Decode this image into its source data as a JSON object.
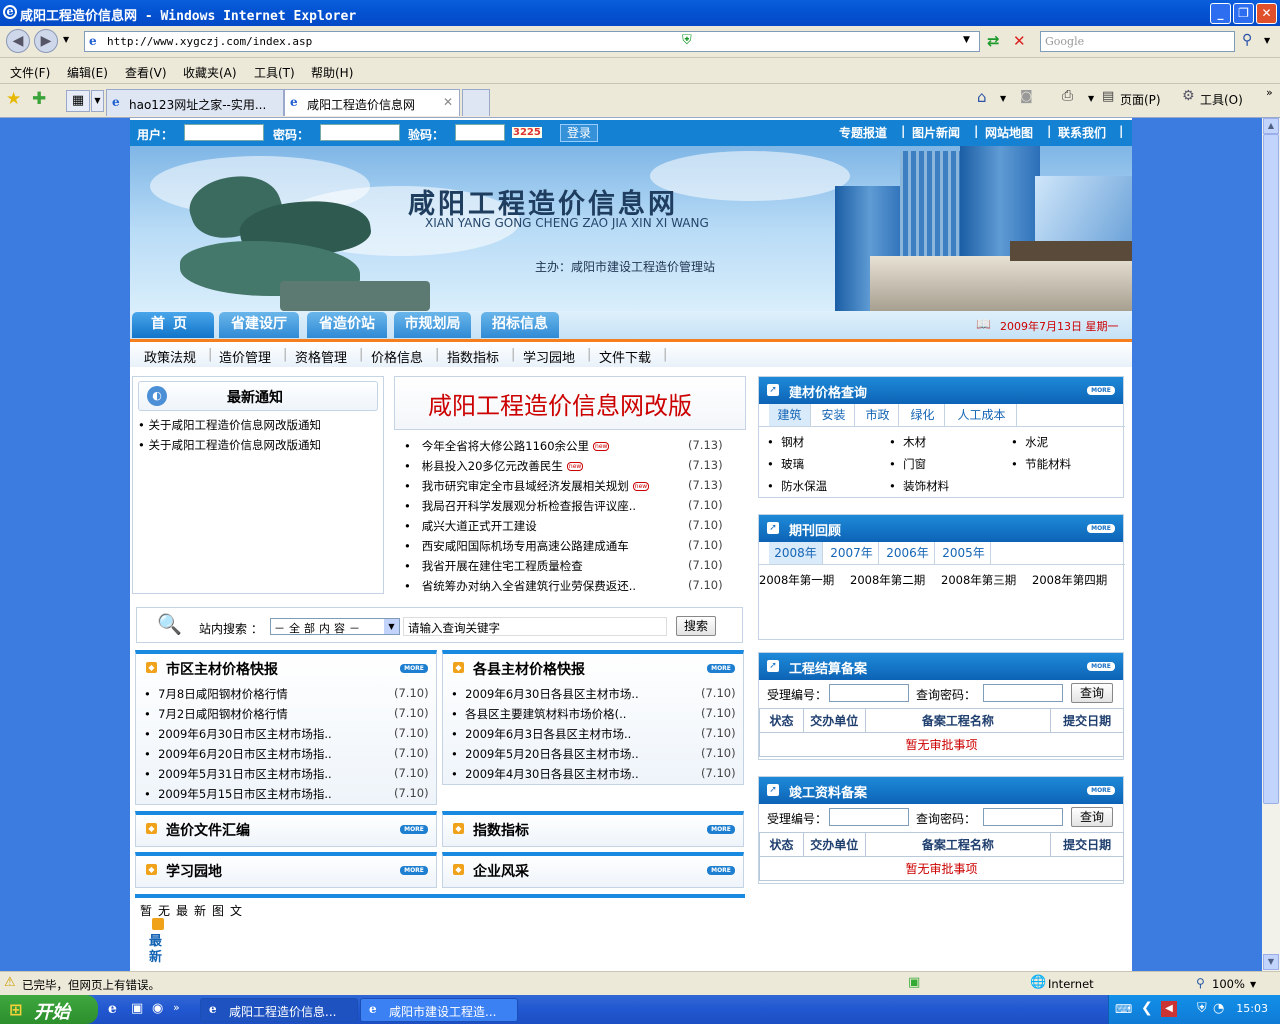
{
  "window": {
    "title": "咸阳工程造价信息网 - Windows Internet Explorer"
  },
  "address": {
    "url": "http://www.xygczj.com/index.asp",
    "search_placeholder": "Google"
  },
  "menu": [
    "文件(F)",
    "编辑(E)",
    "查看(V)",
    "收藏夹(A)",
    "工具(T)",
    "帮助(H)"
  ],
  "browser_tabs": [
    {
      "label": "hao123网址之家--实用..."
    },
    {
      "label": "咸阳工程造价信息网"
    }
  ],
  "toolbar_right": {
    "page": "页面(P)",
    "tools": "工具(O)"
  },
  "login": {
    "user_label": "用户：",
    "pass_label": "密码：",
    "code_label": "验码：",
    "code_value": "3225",
    "login_button": "登录"
  },
  "top_links": [
    "专题报道",
    "图片新闻",
    "网站地图",
    "联系我们"
  ],
  "banner": {
    "title": "咸阳工程造价信息网",
    "pinyin": "XIAN YANG GONG CHENG ZAO JIA XIN XI WANG",
    "sponsor": "主办：咸阳市建设工程造价管理站"
  },
  "main_nav": [
    "首页",
    "省建设厅",
    "省造价站",
    "市规划局",
    "招标信息"
  ],
  "date": "2009年7月13日 星期一",
  "sub_nav": [
    "政策法规",
    "造价管理",
    "资格管理",
    "价格信息",
    "指数指标",
    "学习园地",
    "文件下载"
  ],
  "notices": {
    "title": "最新通知",
    "items": [
      "关于咸阳工程造价信息网改版通知",
      "关于咸阳工程造价信息网改版通知"
    ]
  },
  "headline": {
    "title": "咸阳工程造价信息网改版",
    "items": [
      {
        "text": "今年全省将大修公路1160余公里",
        "date": "(7.13)",
        "new": true
      },
      {
        "text": "彬县投入20多亿元改善民生",
        "date": "(7.13)",
        "new": true
      },
      {
        "text": "我市研究审定全市县域经济发展相关规划",
        "date": "(7.13)",
        "new": true
      },
      {
        "text": "我局召开科学发展观分析检查报告评议座..",
        "date": "(7.10)",
        "new": false
      },
      {
        "text": "咸兴大道正式开工建设",
        "date": "(7.10)",
        "new": false
      },
      {
        "text": "西安咸阳国际机场专用高速公路建成通车",
        "date": "(7.10)",
        "new": false
      },
      {
        "text": "我省开展在建住宅工程质量检查",
        "date": "(7.10)",
        "new": false
      },
      {
        "text": "省统筹办对纳入全省建筑行业劳保费返还..",
        "date": "(7.10)",
        "new": false
      }
    ],
    "new_badge": "new"
  },
  "site_search": {
    "label": "站内搜索 ：",
    "scope": "－全部内容－",
    "placeholder": "请输入查询关键字",
    "button": "搜索"
  },
  "city_prices": {
    "title": "市区主材价格快报",
    "items": [
      {
        "text": "7月8日咸阳钢材价格行情",
        "date": "(7.10)"
      },
      {
        "text": "7月2日咸阳钢材价格行情",
        "date": "(7.10)"
      },
      {
        "text": "2009年6月30日市区主材市场指..",
        "date": "(7.10)"
      },
      {
        "text": "2009年6月20日市区主材市场指..",
        "date": "(7.10)"
      },
      {
        "text": "2009年5月31日市区主材市场指..",
        "date": "(7.10)"
      },
      {
        "text": "2009年5月15日市区主材市场指..",
        "date": "(7.10)"
      }
    ]
  },
  "county_prices": {
    "title": "各县主材价格快报",
    "items": [
      {
        "text": "2009年6月30日各县区主材市场..",
        "date": "(7.10)"
      },
      {
        "text": "各县区主要建筑材料市场价格(..",
        "date": "(7.10)"
      },
      {
        "text": "2009年6月3日各县区主材市场..",
        "date": "(7.10)"
      },
      {
        "text": "2009年5月20日各县区主材市场..",
        "date": "(7.10)"
      },
      {
        "text": "2009年4月30日各县区主材市场..",
        "date": "(7.10)"
      }
    ]
  },
  "sections": {
    "docs": "造价文件汇编",
    "index": "指数指标",
    "study": "学习园地",
    "culture": "企业风采"
  },
  "no_pictures": "暂无最新图文",
  "latest_label": "最新",
  "more_label": "MORE",
  "materials": {
    "title": "建材价格查询",
    "tabs": [
      "建筑",
      "安装",
      "市政",
      "绿化",
      "人工成本"
    ],
    "items": [
      "钢材",
      "木材",
      "水泥",
      "玻璃",
      "门窗",
      "节能材料",
      "防水保温",
      "装饰材料"
    ]
  },
  "periodicals": {
    "title": "期刊回顾",
    "tabs": [
      "2008年",
      "2007年",
      "2006年",
      "2005年"
    ],
    "items": [
      "2008年第一期",
      "2008年第二期",
      "2008年第三期",
      "2008年第四期"
    ]
  },
  "settlement": {
    "title": "工程结算备案",
    "id_label": "受理编号：",
    "pwd_label": "查询密码：",
    "button": "查询",
    "columns": [
      "状态",
      "交办单位",
      "备案工程名称",
      "提交日期"
    ],
    "empty": "暂无审批事项"
  },
  "completion": {
    "title": "竣工资料备案",
    "id_label": "受理编号：",
    "pwd_label": "查询密码：",
    "button": "查询",
    "columns": [
      "状态",
      "交办单位",
      "备案工程名称",
      "提交日期"
    ],
    "empty": "暂无审批事项"
  },
  "status": {
    "text": "已完毕，但网页上有错误。",
    "zone": "Internet",
    "zoom": "100%"
  },
  "taskbar": {
    "start": "开始",
    "tasks": [
      "咸阳工程造价信息...",
      "咸阳市建设工程造..."
    ],
    "clock": "15:03"
  },
  "colors": {
    "accent_blue": "#1581d2",
    "nav_orange": "#f57e1e",
    "headline_red": "#cc0000"
  }
}
